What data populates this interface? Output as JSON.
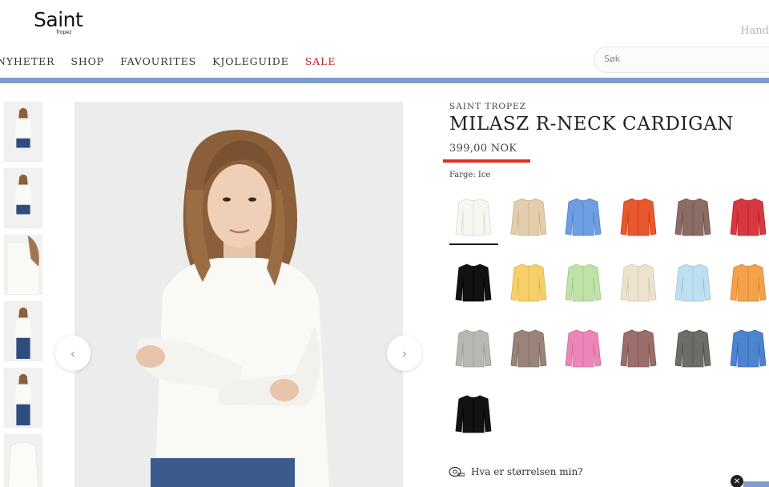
{
  "header": {
    "logo_main": "Saint",
    "logo_sub": "Tropez",
    "top_right_link": "Hand",
    "nav": [
      {
        "label": "NYHETER",
        "sale": false
      },
      {
        "label": "SHOP",
        "sale": false
      },
      {
        "label": "FAVOURITES",
        "sale": false
      },
      {
        "label": "KJOLEGUIDE",
        "sale": false
      },
      {
        "label": "SALE",
        "sale": true
      }
    ],
    "search_placeholder": "Søk",
    "accent_color": "#7e9ccd",
    "sale_color": "#c2272d"
  },
  "gallery": {
    "thumbnails": [
      {
        "name": "front-view"
      },
      {
        "name": "side-view"
      },
      {
        "name": "detail-view"
      },
      {
        "name": "full-body-view"
      },
      {
        "name": "back-view"
      },
      {
        "name": "flat-view"
      }
    ],
    "prev_icon": "chevron-left-icon",
    "next_icon": "chevron-right-icon"
  },
  "product": {
    "brand": "SAINT TROPEZ",
    "title": "MILASZ R-NECK CARDIGAN",
    "price": "399,00 NOK",
    "price_accent": "#e0301e",
    "color_label": "Farge: Ice",
    "swatches": [
      {
        "color": "#f7f6f1",
        "selected": true
      },
      {
        "color": "#e3ceac",
        "selected": false
      },
      {
        "color": "#6f9de2",
        "selected": false
      },
      {
        "color": "#e8582f",
        "selected": false
      },
      {
        "color": "#8a6e66",
        "selected": false
      },
      {
        "color": "#d8383f",
        "selected": false
      },
      {
        "color": "#121212",
        "selected": false
      },
      {
        "color": "#f6cf6a",
        "selected": false
      },
      {
        "color": "#bfe2a6",
        "selected": false
      },
      {
        "color": "#ece3cf",
        "selected": false
      },
      {
        "color": "#bcdff2",
        "selected": false
      },
      {
        "color": "#f3a24a",
        "selected": false
      },
      {
        "color": "#b7b7b4",
        "selected": false
      },
      {
        "color": "#9a8479",
        "selected": false
      },
      {
        "color": "#ec86b8",
        "selected": false
      },
      {
        "color": "#9a6e6a",
        "selected": false
      },
      {
        "color": "#6e6c69",
        "selected": false
      },
      {
        "color": "#4d84cf",
        "selected": false
      },
      {
        "color": "#121212",
        "selected": false
      }
    ],
    "size_help": "Hva er størrelsen min?",
    "size_help_icon": "tape-measure-icon"
  },
  "widget": {
    "close_icon": "close-icon"
  }
}
